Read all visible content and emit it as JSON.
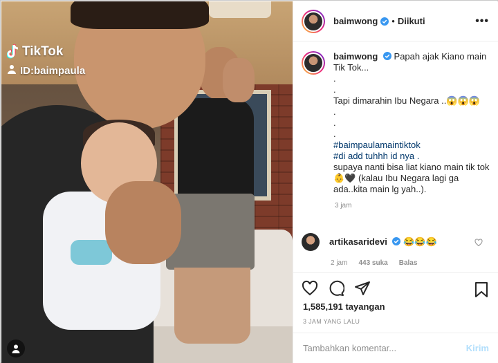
{
  "media": {
    "tiktok_label": "TikTok",
    "tiktok_id": "ID:baimpaula"
  },
  "header": {
    "username": "baimwong",
    "separator": "•",
    "follow_label": "Diikuti",
    "more_label": "•••"
  },
  "caption": {
    "username": "baimwong",
    "lines": [
      "Papah ajak Kiano main Tik Tok...",
      ".",
      ".",
      "Tapi dimarahin Ibu Negara ..😱😱😱",
      ".",
      ".",
      ".",
      "#baimpaulamaintiktok",
      "#di add tuhhh id nya .",
      "supaya nanti bisa liat kiano main tik tok 👶🖤 (kalau Ibu Negara lagi ga ada..kita main lg yah..)."
    ],
    "time": "3 jam"
  },
  "comment": {
    "username": "artikasaridevi",
    "text": "😂😂😂",
    "time": "2 jam",
    "likes": "443 suka",
    "reply_label": "Balas"
  },
  "stats": {
    "views": "1,585,191 tayangan",
    "posted_ago": "3 JAM YANG LALU"
  },
  "add_comment": {
    "placeholder": "Tambahkan komentar...",
    "send_label": "Kirim"
  },
  "colors": {
    "verified": "#3897f0",
    "hashtag": "#00376b",
    "send_disabled": "#b2dffc",
    "muted": "#8e8e8e"
  }
}
